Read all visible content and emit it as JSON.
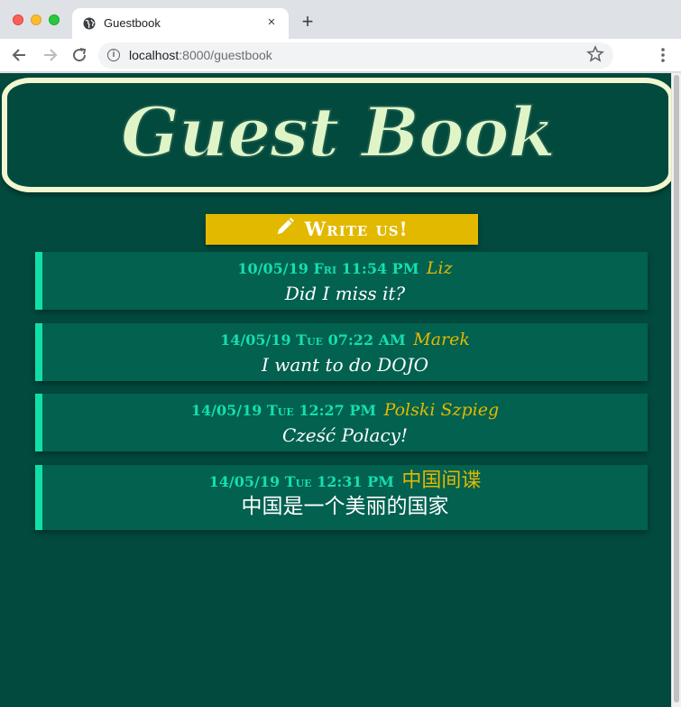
{
  "browser": {
    "tab_title": "Guestbook",
    "tab_close": "×",
    "new_tab": "+",
    "url_host": "localhost",
    "url_rest": ":8000/guestbook",
    "icons": {
      "tab_favicon": "globe-icon",
      "back": "arrow-left-icon",
      "forward": "arrow-right-icon",
      "reload": "reload-icon",
      "info": "info-icon",
      "bookmark": "star-icon",
      "menu": "kebab-menu-icon"
    }
  },
  "header": {
    "title": "Guest Book"
  },
  "write_button": {
    "label": "Write us!",
    "icon": "pencil-icon"
  },
  "entries": [
    {
      "date": "10/05/19 Fri 11:54 PM",
      "author": "Liz",
      "message": "Did I miss it?"
    },
    {
      "date": "14/05/19 Tue 07:22 AM",
      "author": "Marek",
      "message": "I want to do DOJO"
    },
    {
      "date": "14/05/19 Tue 12:27 PM",
      "author": "Polski Szpieg",
      "message": "Cześć Polacy!"
    },
    {
      "date": "14/05/19 Tue 12:31 PM",
      "author": "中国间谍",
      "message": "中国是一个美丽的国家"
    }
  ],
  "colors": {
    "page_background": "#024a3e",
    "entry_background": "#02614f",
    "entry_accent": "#10e0a8",
    "date_text": "#14dfb0",
    "author_text": "#e3b900",
    "button_background": "#e3b900",
    "header_border": "#f1f8cf"
  }
}
